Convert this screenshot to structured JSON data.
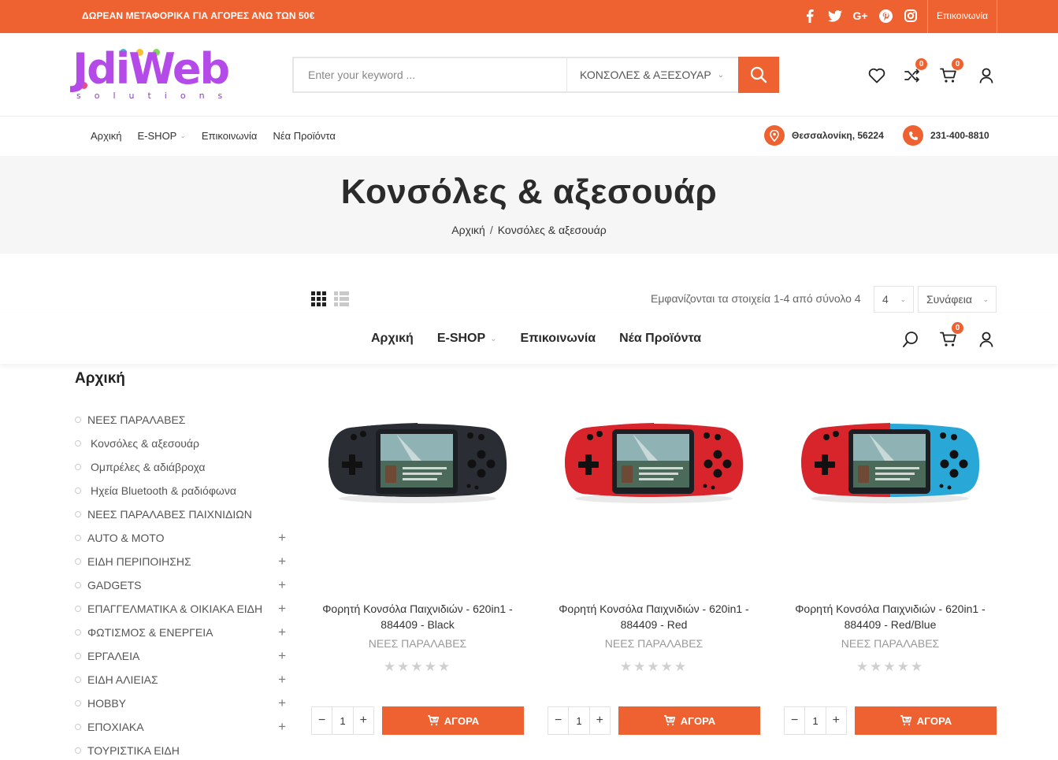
{
  "topbar": {
    "promo": "ΔΩΡΕΑΝ ΜΕΤΑΦΟΡΙΚΑ ΓΙΑ ΑΓΟΡΕΣ ΑΝΩ ΤΩΝ 50€",
    "socials": [
      "facebook-icon",
      "twitter-icon",
      "google-plus-icon",
      "pinterest-icon",
      "instagram-icon"
    ],
    "contact_label": "Επικοινωνία"
  },
  "logo": {
    "word": "JdiWeb",
    "sub": "solutions"
  },
  "search": {
    "placeholder": "Enter your keyword ...",
    "category": "ΚΟΝΣΟΛΕΣ & ΑΞΕΣΟΥΑΡ"
  },
  "header_icons": {
    "compare_count": "0",
    "cart_count": "0"
  },
  "nav": {
    "items": [
      "Αρχική",
      "E-SHOP",
      "Επικοινωνία",
      "Νέα Προϊόντα"
    ]
  },
  "contact_info": {
    "address": "Θεσσαλονίκη, 56224",
    "phone": "231-400-8810"
  },
  "page": {
    "title": "Κονσόλες & αξεσουάρ",
    "breadcrumb": [
      "Αρχική",
      "Κονσόλες & αξεσουάρ"
    ]
  },
  "toolbar": {
    "result_text": "Εμφανίζονται τα στοιχεία 1-4 από σύνολο 4",
    "per_page": "4",
    "sort": "Συνάφεια"
  },
  "sticky_nav": {
    "items": [
      "Αρχική",
      "E-SHOP",
      "Επικοινωνία",
      "Νέα Προϊόντα"
    ],
    "cart_count": "0"
  },
  "sidebar": {
    "title": "Αρχική",
    "items": [
      {
        "label": "ΝΕΕΣ ΠΑΡΑΛΑΒΕΣ",
        "expandable": false
      },
      {
        "label": "Κονσόλες & αξεσουάρ",
        "expandable": false
      },
      {
        "label": "Ομπρέλες & αδιάβροχα",
        "expandable": false
      },
      {
        "label": "Ηχεία Bluetooth & ραδιόφωνα",
        "expandable": false
      },
      {
        "label": "ΝΕΕΣ ΠΑΡΑΛΑΒΕΣ ΠΑΙΧΝΙΔΙΩΝ",
        "expandable": false
      },
      {
        "label": "AUTO & MOTO",
        "expandable": true
      },
      {
        "label": "ΕΙΔΗ ΠΕΡΙΠΟΙΗΣΗΣ",
        "expandable": true
      },
      {
        "label": "GADGETS",
        "expandable": true
      },
      {
        "label": "ΕΠΑΓΓΕΛΜΑΤΙΚΑ & ΟΙΚΙΑΚΑ ΕΙΔΗ",
        "expandable": true
      },
      {
        "label": "ΦΩΤΙΣΜΟΣ & ΕΝΕΡΓΕΙΑ",
        "expandable": true
      },
      {
        "label": "ΕΡΓΑΛΕΙΑ",
        "expandable": true
      },
      {
        "label": "ΕΙΔΗ ΑΛΙΕΙΑΣ",
        "expandable": true
      },
      {
        "label": "HOBBY",
        "expandable": true
      },
      {
        "label": "ΕΠΟΧΙΑΚΑ",
        "expandable": true
      },
      {
        "label": "ΤΟΥΡΙΣΤΙΚΑ ΕΙΔΗ",
        "expandable": false
      }
    ]
  },
  "products": [
    {
      "name_line1": "Φορητή Κονσόλα Παιχνιδιών - 620in1 -",
      "name_line2": "884409 - Black",
      "category": "ΝΕΕΣ ΠΑΡΑΛΑΒΕΣ",
      "qty": "1",
      "buy_label": "ΑΓΟΡΑ",
      "left_color": "#2a2d33",
      "right_color": "#2a2d33",
      "rating": 0
    },
    {
      "name_line1": "Φορητή Κονσόλα Παιχνιδιών - 620in1 -",
      "name_line2": "884409 - Red",
      "category": "ΝΕΕΣ ΠΑΡΑΛΑΒΕΣ",
      "qty": "1",
      "buy_label": "ΑΓΟΡΑ",
      "left_color": "#d8252c",
      "right_color": "#d8252c",
      "rating": 0
    },
    {
      "name_line1": "Φορητή Κονσόλα Παιχνιδιών - 620in1 -",
      "name_line2": "884409 - Red/Blue",
      "category": "ΝΕΕΣ ΠΑΡΑΛΑΒΕΣ",
      "qty": "1",
      "buy_label": "ΑΓΟΡΑ",
      "left_color": "#d8252c",
      "right_color": "#29a8d8",
      "rating": 0
    }
  ],
  "colors": {
    "accent": "#ee6232"
  }
}
